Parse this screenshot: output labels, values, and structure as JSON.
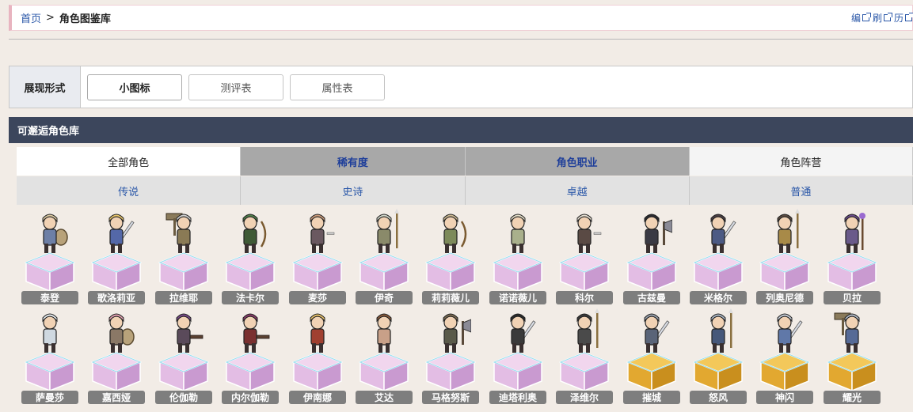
{
  "breadcrumb": {
    "home": "首页",
    "separator": ">",
    "current": "角色图鉴库"
  },
  "tools": {
    "edit": "编",
    "refresh": "刷",
    "history": "历"
  },
  "display_mode": {
    "label": "展现形式",
    "buttons": [
      {
        "label": "小图标",
        "active": true
      },
      {
        "label": "测评表",
        "active": false
      },
      {
        "label": "属性表",
        "active": false
      }
    ]
  },
  "section": {
    "title": "可邂逅角色库"
  },
  "filters": {
    "tabs": [
      {
        "label": "全部角色",
        "style": "all"
      },
      {
        "label": "稀有度",
        "style": "dark"
      },
      {
        "label": "角色职业",
        "style": "dark"
      },
      {
        "label": "角色阵营",
        "style": "light"
      }
    ],
    "rarity": [
      {
        "label": "传说"
      },
      {
        "label": "史诗"
      },
      {
        "label": "卓越"
      },
      {
        "label": "普通"
      }
    ]
  },
  "colors": {
    "pedestal_pink": "#e7b7de",
    "pedestal_gold": "#e7b03a",
    "name_tag": "#7e7e7e",
    "section_header": "#3c465c",
    "link": "#2a57a8"
  },
  "characters": [
    {
      "name": "泰登",
      "pedestal": "pink",
      "hair": "#d8c7a0",
      "body": "#6d7fa6",
      "prop": "shield"
    },
    {
      "name": "歌洛莉亚",
      "pedestal": "pink",
      "hair": "#e6c46a",
      "body": "#5468a8",
      "prop": "sword"
    },
    {
      "name": "拉维耶",
      "pedestal": "pink",
      "hair": "#cfcfcf",
      "body": "#8a7a55",
      "prop": "hammer"
    },
    {
      "name": "法卡尔",
      "pedestal": "pink",
      "hair": "#4f7f4a",
      "body": "#3f5a36",
      "prop": "bow"
    },
    {
      "name": "麦莎",
      "pedestal": "pink",
      "hair": "#c99a7a",
      "body": "#6a5860",
      "prop": "dagger"
    },
    {
      "name": "伊奇",
      "pedestal": "pink",
      "hair": "#cfd4c8",
      "body": "#8a8a6a",
      "prop": "spear"
    },
    {
      "name": "莉莉薇儿",
      "pedestal": "pink",
      "hair": "#c9b690",
      "body": "#7d8a5a",
      "prop": "bow"
    },
    {
      "name": "诺诺薇儿",
      "pedestal": "pink",
      "hair": "#e2dcc6",
      "body": "#a9b08c",
      "prop": "none"
    },
    {
      "name": "科尔",
      "pedestal": "pink",
      "hair": "#e4ddd0",
      "body": "#5a4a44",
      "prop": "dagger"
    },
    {
      "name": "古兹曼",
      "pedestal": "pink",
      "hair": "#2a2a30",
      "body": "#3a3a44",
      "prop": "axe"
    },
    {
      "name": "米格尔",
      "pedestal": "pink",
      "hair": "#4a3e44",
      "body": "#4c5a84",
      "prop": "sword"
    },
    {
      "name": "列奥尼德",
      "pedestal": "pink",
      "hair": "#5a4a40",
      "body": "#a88a48",
      "prop": "spear"
    },
    {
      "name": "贝拉",
      "pedestal": "pink",
      "hair": "#6a4a8a",
      "body": "#6a5a8a",
      "prop": "staff"
    },
    {
      "name": "萨曼莎",
      "pedestal": "pink",
      "hair": "#e8eef2",
      "body": "#cfd8e0",
      "prop": "none"
    },
    {
      "name": "嘉西娅",
      "pedestal": "pink",
      "hair": "#e2a0b0",
      "body": "#8a7866",
      "prop": "shield"
    },
    {
      "name": "伦伽勒",
      "pedestal": "pink",
      "hair": "#7a4a8a",
      "body": "#5a4a5a",
      "prop": "gun"
    },
    {
      "name": "内尔伽勒",
      "pedestal": "pink",
      "hair": "#8a3a6a",
      "body": "#7a3030",
      "prop": "gun"
    },
    {
      "name": "伊南娜",
      "pedestal": "pink",
      "hair": "#e6c06a",
      "body": "#a04030",
      "prop": "none"
    },
    {
      "name": "艾达",
      "pedestal": "pink",
      "hair": "#8a5a3a",
      "body": "#c8a088",
      "prop": "none"
    },
    {
      "name": "马格努斯",
      "pedestal": "pink",
      "hair": "#7a6a50",
      "body": "#5a5a4a",
      "prop": "axe"
    },
    {
      "name": "迪塔利奥",
      "pedestal": "pink",
      "hair": "#2a2a2a",
      "body": "#3a3a3a",
      "prop": "sword"
    },
    {
      "name": "泽维尔",
      "pedestal": "pink",
      "hair": "#3a3a3a",
      "body": "#4a4a4a",
      "prop": "spear"
    },
    {
      "name": "摧城",
      "pedestal": "gold",
      "hair": "#9aa2ae",
      "body": "#5a6478",
      "prop": "sword"
    },
    {
      "name": "怒风",
      "pedestal": "gold",
      "hair": "#aab6c4",
      "body": "#46587a",
      "prop": "spear"
    },
    {
      "name": "神闪",
      "pedestal": "gold",
      "hair": "#c6ccd6",
      "body": "#6078a8",
      "prop": "sword"
    },
    {
      "name": "耀光",
      "pedestal": "gold",
      "hair": "#b0b8c4",
      "body": "#566a96",
      "prop": "hammer"
    }
  ]
}
